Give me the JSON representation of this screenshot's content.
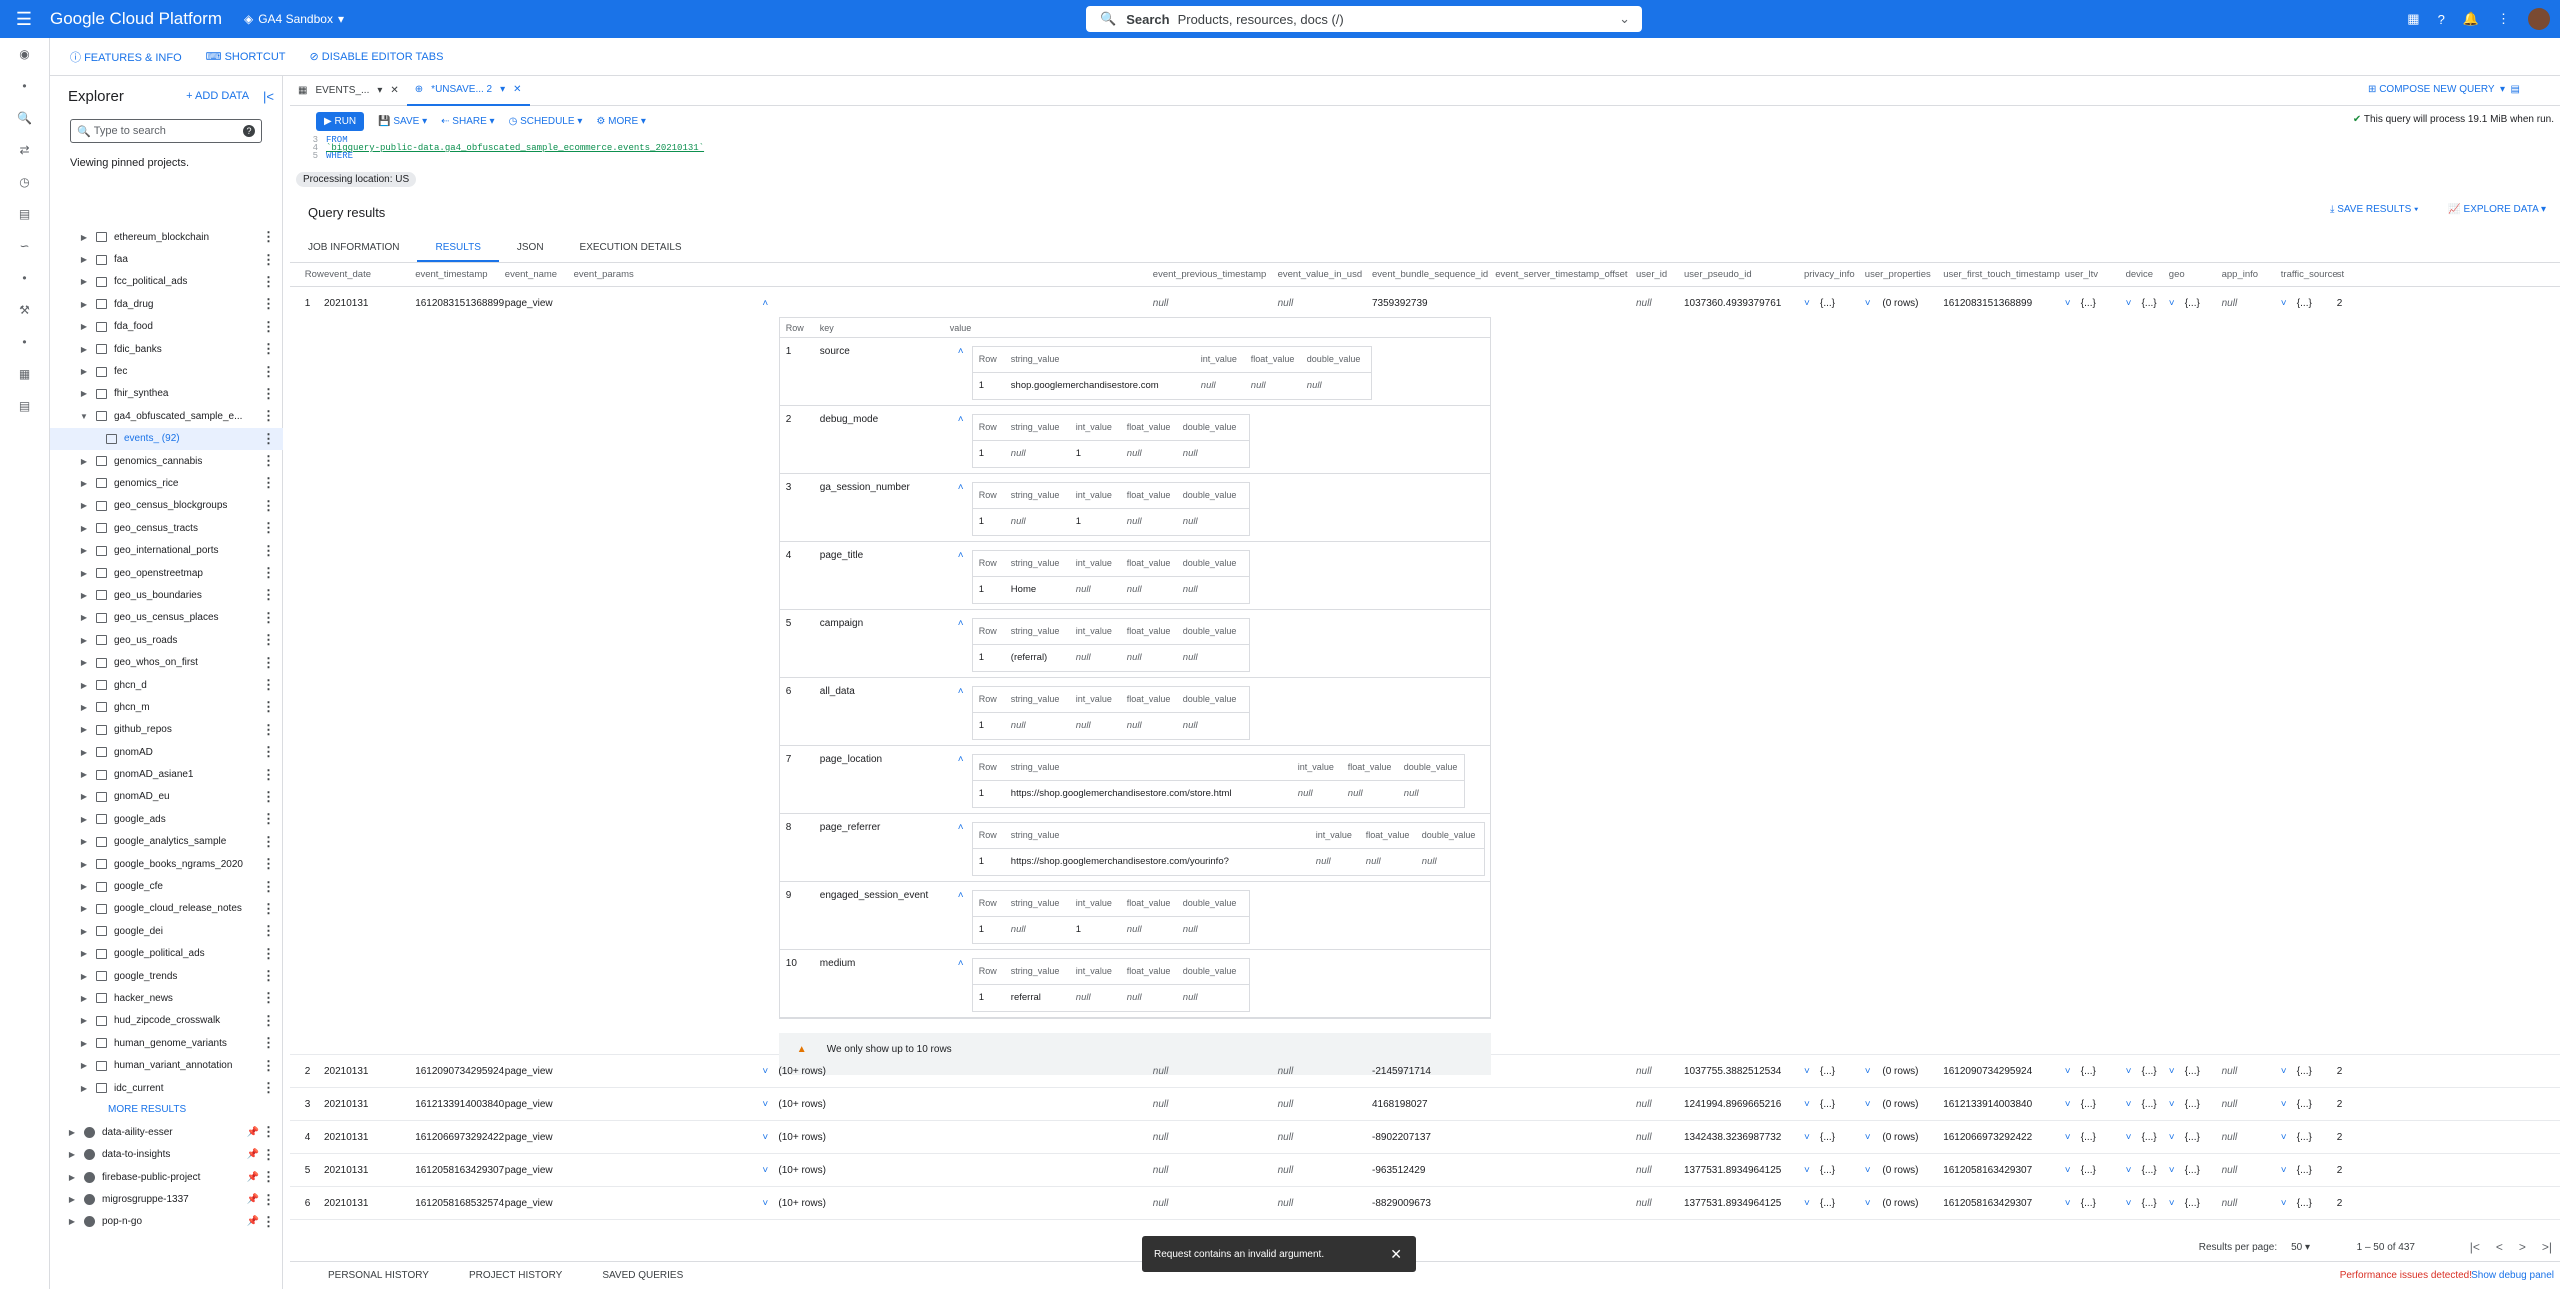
{
  "app": {
    "brand": "Google Cloud Platform",
    "project": "GA4 Sandbox",
    "search_label": "Search",
    "search_placeholder": "Products, resources, docs (/)"
  },
  "toolbar": {
    "features": "FEATURES & INFO",
    "shortcut": "SHORTCUT",
    "disable_tabs": "DISABLE EDITOR TABS"
  },
  "explorer": {
    "title": "Explorer",
    "add_data": "+ ADD DATA",
    "search_placeholder": "Type to search",
    "pinned": "Viewing pinned projects.",
    "more_results": "MORE RESULTS",
    "items": [
      "ethereum_blockchain",
      "faa",
      "fcc_political_ads",
      "fda_drug",
      "fda_food",
      "fdic_banks",
      "fec",
      "fhir_synthea",
      "ga4_obfuscated_sample_e...",
      "events_ (92)",
      "genomics_cannabis",
      "genomics_rice",
      "geo_census_blockgroups",
      "geo_census_tracts",
      "geo_international_ports",
      "geo_openstreetmap",
      "geo_us_boundaries",
      "geo_us_census_places",
      "geo_us_roads",
      "geo_whos_on_first",
      "ghcn_d",
      "ghcn_m",
      "github_repos",
      "gnomAD",
      "gnomAD_asiane1",
      "gnomAD_eu",
      "google_ads",
      "google_analytics_sample",
      "google_books_ngrams_2020",
      "google_cfe",
      "google_cloud_release_notes",
      "google_dei",
      "google_political_ads",
      "google_trends",
      "hacker_news",
      "hud_zipcode_crosswalk",
      "human_genome_variants",
      "human_variant_annotation",
      "idc_current"
    ],
    "projects": [
      "data-aility-esser",
      "data-to-insights",
      "firebase-public-project",
      "migrosgruppe-1337",
      "pop-n-go"
    ]
  },
  "editor": {
    "tab1": "EVENTS_...",
    "tab2": "*UNSAVE... 2",
    "compose": "COMPOSE NEW QUERY",
    "run": "RUN",
    "save": "SAVE",
    "share": "SHARE",
    "schedule": "SCHEDULE",
    "more": "MORE",
    "process_msg": "This query will process 19.1 MiB when run.",
    "code": [
      {
        "n": "3",
        "t": "FROM"
      },
      {
        "n": "4",
        "t": "`bigquery-public-data.ga4_obfuscated_sample_ecommerce.events_20210131`"
      },
      {
        "n": "5",
        "t": "WHERE"
      }
    ],
    "proc_loc": "Processing location: US"
  },
  "results": {
    "title": "Query results",
    "save": "SAVE RESULTS",
    "explore": "EXPLORE DATA",
    "tabs": [
      "JOB INFORMATION",
      "RESULTS",
      "JSON",
      "EXECUTION DETAILS"
    ],
    "headers": [
      "Row",
      "event_date",
      "event_timestamp",
      "event_name",
      "event_params",
      "event_previous_timestamp",
      "event_value_in_usd",
      "event_bundle_sequence_id",
      "event_server_timestamp_offset",
      "user_id",
      "user_pseudo_id",
      "privacy_info",
      "user_properties",
      "user_first_touch_timestamp",
      "user_ltv",
      "device",
      "geo",
      "app_info",
      "traffic_source",
      "st"
    ],
    "nested_headers": [
      "Row",
      "key",
      "value"
    ],
    "params": [
      {
        "n": "1",
        "key": "source",
        "cols": [
          "Row",
          "string_value",
          "int_value",
          "float_value",
          "double_value"
        ],
        "vals": [
          "1",
          "shop.googlemerchandisestore.com",
          "null",
          "null",
          "null"
        ]
      },
      {
        "n": "2",
        "key": "debug_mode",
        "cols": [
          "Row",
          "string_value",
          "int_value",
          "float_value",
          "double_value"
        ],
        "vals": [
          "1",
          "null",
          "1",
          "null",
          "null"
        ]
      },
      {
        "n": "3",
        "key": "ga_session_number",
        "cols": [
          "Row",
          "string_value",
          "int_value",
          "float_value",
          "double_value"
        ],
        "vals": [
          "1",
          "null",
          "1",
          "null",
          "null"
        ]
      },
      {
        "n": "4",
        "key": "page_title",
        "cols": [
          "Row",
          "string_value",
          "int_value",
          "float_value",
          "double_value"
        ],
        "vals": [
          "1",
          "Home",
          "null",
          "null",
          "null"
        ]
      },
      {
        "n": "5",
        "key": "campaign",
        "cols": [
          "Row",
          "string_value",
          "int_value",
          "float_value",
          "double_value"
        ],
        "vals": [
          "1",
          "(referral)",
          "null",
          "null",
          "null"
        ]
      },
      {
        "n": "6",
        "key": "all_data",
        "cols": [
          "Row",
          "string_value",
          "int_value",
          "float_value",
          "double_value"
        ],
        "vals": [
          "1",
          "null",
          "null",
          "null",
          "null"
        ]
      },
      {
        "n": "7",
        "key": "page_location",
        "cols": [
          "Row",
          "string_value",
          "int_value",
          "float_value",
          "double_value"
        ],
        "vals": [
          "1",
          "https://shop.googlemerchandisestore.com/store.html",
          "null",
          "null",
          "null"
        ]
      },
      {
        "n": "8",
        "key": "page_referrer",
        "cols": [
          "Row",
          "string_value",
          "int_value",
          "float_value",
          "double_value"
        ],
        "vals": [
          "1",
          "https://shop.googlemerchandisestore.com/yourinfo?",
          "null",
          "null",
          "null"
        ]
      },
      {
        "n": "9",
        "key": "engaged_session_event",
        "cols": [
          "Row",
          "string_value",
          "int_value",
          "float_value",
          "double_value"
        ],
        "vals": [
          "1",
          "null",
          "1",
          "null",
          "null"
        ]
      },
      {
        "n": "10",
        "key": "medium",
        "cols": [
          "Row",
          "string_value",
          "int_value",
          "float_value",
          "double_value"
        ],
        "vals": [
          "1",
          "referral",
          "null",
          "null",
          "null"
        ]
      }
    ],
    "warning": "We only show up to 10 rows",
    "row1": {
      "row": "1",
      "date": "20210131",
      "ts": "1612083151368899",
      "name": "page_view",
      "prev": "null",
      "usd": "null",
      "bundle": "7359392739",
      "offset": "null",
      "uid": "null",
      "pseudo": "1037360.4939379761",
      "privacy": "{...}",
      "props": "(0 rows)",
      "first": "1612083151368899",
      "ltv": "{...}",
      "device": "{...}",
      "geo": "{...}",
      "app": "null",
      "traffic": "{...}",
      "st": "2"
    },
    "rows": [
      {
        "row": "2",
        "date": "20210131",
        "ts": "1612090734295924",
        "name": "page_view",
        "params": "(10+ rows)",
        "prev": "null",
        "usd": "null",
        "bundle": "-2145971714",
        "offset": "null",
        "uid": "null",
        "pseudo": "1037755.3882512534",
        "privacy": "{...}",
        "props": "(0 rows)",
        "first": "1612090734295924",
        "ltv": "{...}",
        "device": "{...}",
        "geo": "{...}",
        "app": "null",
        "traffic": "{...}",
        "st": "2"
      },
      {
        "row": "3",
        "date": "20210131",
        "ts": "1612133914003840",
        "name": "page_view",
        "params": "(10+ rows)",
        "prev": "null",
        "usd": "null",
        "bundle": "4168198027",
        "offset": "null",
        "uid": "null",
        "pseudo": "1241994.8969665216",
        "privacy": "{...}",
        "props": "(0 rows)",
        "first": "1612133914003840",
        "ltv": "{...}",
        "device": "{...}",
        "geo": "{...}",
        "app": "null",
        "traffic": "{...}",
        "st": "2"
      },
      {
        "row": "4",
        "date": "20210131",
        "ts": "1612066973292422",
        "name": "page_view",
        "params": "(10+ rows)",
        "prev": "null",
        "usd": "null",
        "bundle": "-8902207137",
        "offset": "null",
        "uid": "null",
        "pseudo": "1342438.3236987732",
        "privacy": "{...}",
        "props": "(0 rows)",
        "first": "1612066973292422",
        "ltv": "{...}",
        "device": "{...}",
        "geo": "{...}",
        "app": "null",
        "traffic": "{...}",
        "st": "2"
      },
      {
        "row": "5",
        "date": "20210131",
        "ts": "1612058163429307",
        "name": "page_view",
        "params": "(10+ rows)",
        "prev": "null",
        "usd": "null",
        "bundle": "-963512429",
        "offset": "null",
        "uid": "null",
        "pseudo": "1377531.8934964125",
        "privacy": "{...}",
        "props": "(0 rows)",
        "first": "1612058163429307",
        "ltv": "{...}",
        "device": "{...}",
        "geo": "{...}",
        "app": "null",
        "traffic": "{...}",
        "st": "2"
      },
      {
        "row": "6",
        "date": "20210131",
        "ts": "1612058168532574",
        "name": "page_view",
        "params": "(10+ rows)",
        "prev": "null",
        "usd": "null",
        "bundle": "-8829009673",
        "offset": "null",
        "uid": "null",
        "pseudo": "1377531.8934964125",
        "privacy": "{...}",
        "props": "(0 rows)",
        "first": "1612058163429307",
        "ltv": "{...}",
        "device": "{...}",
        "geo": "{...}",
        "app": "null",
        "traffic": "{...}",
        "st": "2"
      }
    ],
    "per_page_label": "Results per page:",
    "per_page": "50",
    "range": "1 – 50 of 437"
  },
  "history": {
    "personal": "PERSONAL HISTORY",
    "project": "PROJECT HISTORY",
    "saved": "SAVED QUERIES",
    "perf": "Performance issues detected!",
    "debug": "Show debug panel"
  },
  "toast": {
    "msg": "Request contains an invalid argument."
  }
}
